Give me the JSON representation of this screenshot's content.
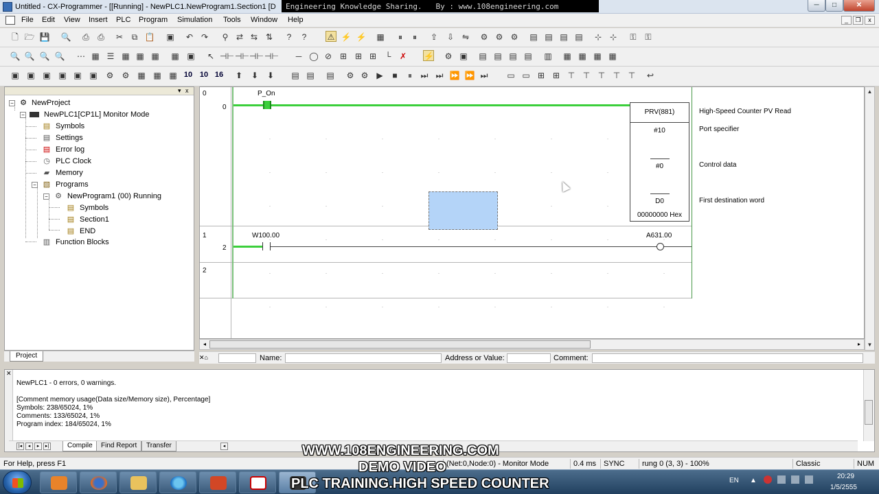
{
  "window": {
    "title": "Untitled - CX-Programmer - [[Running] - NewPLC1.NewProgram1.Section1 [D",
    "banner": "Engineering Knowledge Sharing.   By : www.108engineering.com"
  },
  "menu": [
    "File",
    "Edit",
    "View",
    "Insert",
    "PLC",
    "Program",
    "Simulation",
    "Tools",
    "Window",
    "Help"
  ],
  "tree": {
    "root": "NewProject",
    "plc": "NewPLC1[CP1L] Monitor Mode",
    "symbols": "Symbols",
    "settings": "Settings",
    "error_log": "Error log",
    "plc_clock": "PLC Clock",
    "memory": "Memory",
    "programs": "Programs",
    "program": "NewProgram1 (00) Running",
    "prog_symbols": "Symbols",
    "section": "Section1",
    "end": "END",
    "function_blocks": "Function Blocks",
    "tab": "Project"
  },
  "ladder": {
    "rung0": {
      "rung_no": "0",
      "step_no": "0",
      "contact": "P_On",
      "instruction": "PRV(881)",
      "op1": "#10",
      "op2": "#0",
      "op3": "D0",
      "op3_value": "00000000 Hex",
      "comment_instr": "High-Speed Counter PV Read",
      "comment_op1": "Port specifier",
      "comment_op2": "Control data",
      "comment_op3": "First destination word"
    },
    "rung1": {
      "rung_no": "1",
      "step_no": "2",
      "contact": "W100.00",
      "coil": "A631.00"
    },
    "rung2": {
      "rung_no": "2"
    }
  },
  "info": {
    "name_label": "Name:",
    "address_label": "Address or Value:",
    "comment_label": "Comment:"
  },
  "output": {
    "lines": [
      "NewPLC1 - 0 errors, 0 warnings.",
      "",
      "[Comment memory usage(Data size/Memory size), Percentage]",
      "Symbols: 238/65024, 1%",
      "Comments: 133/65024, 1%",
      "Program index: 184/65024, 1%"
    ],
    "tabs": [
      "Compile",
      "Find Report",
      "Transfer"
    ]
  },
  "status": {
    "help": "For Help, press F1",
    "node": "(Net:0,Node:0) - Monitor Mode",
    "scan": "0.4 ms",
    "sync": "SYNC",
    "rung": "rung 0 (3, 3)  - 100%",
    "mode": "Classic",
    "num": "NUM"
  },
  "watermark": {
    "line1": "WWW.108ENGINEERING.COM",
    "line2": "DEMO VIDEO",
    "line3": "PLC TRAINING.HIGH SPEED COUNTER"
  },
  "tray": {
    "lang": "EN",
    "time": "20:29",
    "date": "1/5/2555"
  }
}
